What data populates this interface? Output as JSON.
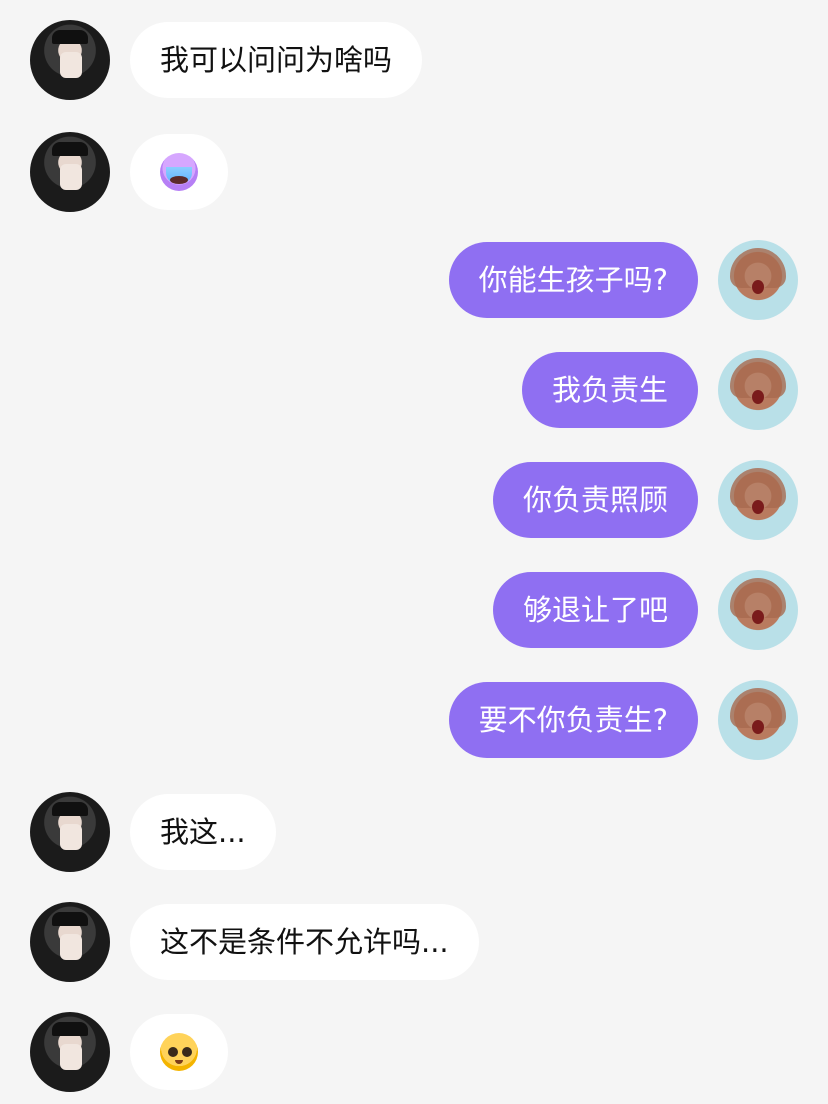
{
  "theme": {
    "background": "#f5f5f5",
    "incoming_bubble": "#ffffff",
    "outgoing_bubble": "#8f6ff2"
  },
  "messages": [
    {
      "side": "left",
      "text": "我可以问问为啥吗"
    },
    {
      "side": "left",
      "emoji": "crying-face-emoji"
    },
    {
      "side": "right",
      "text": "你能生孩子吗?"
    },
    {
      "side": "right",
      "text": "我负责生"
    },
    {
      "side": "right",
      "text": "你负责照顾"
    },
    {
      "side": "right",
      "text": "够退让了吧"
    },
    {
      "side": "right",
      "text": "要不你负责生?"
    },
    {
      "side": "left",
      "text": "我这..."
    },
    {
      "side": "left",
      "text": "这不是条件不允许吗..."
    },
    {
      "side": "left",
      "emoji": "pleading-face-emoji"
    }
  ]
}
